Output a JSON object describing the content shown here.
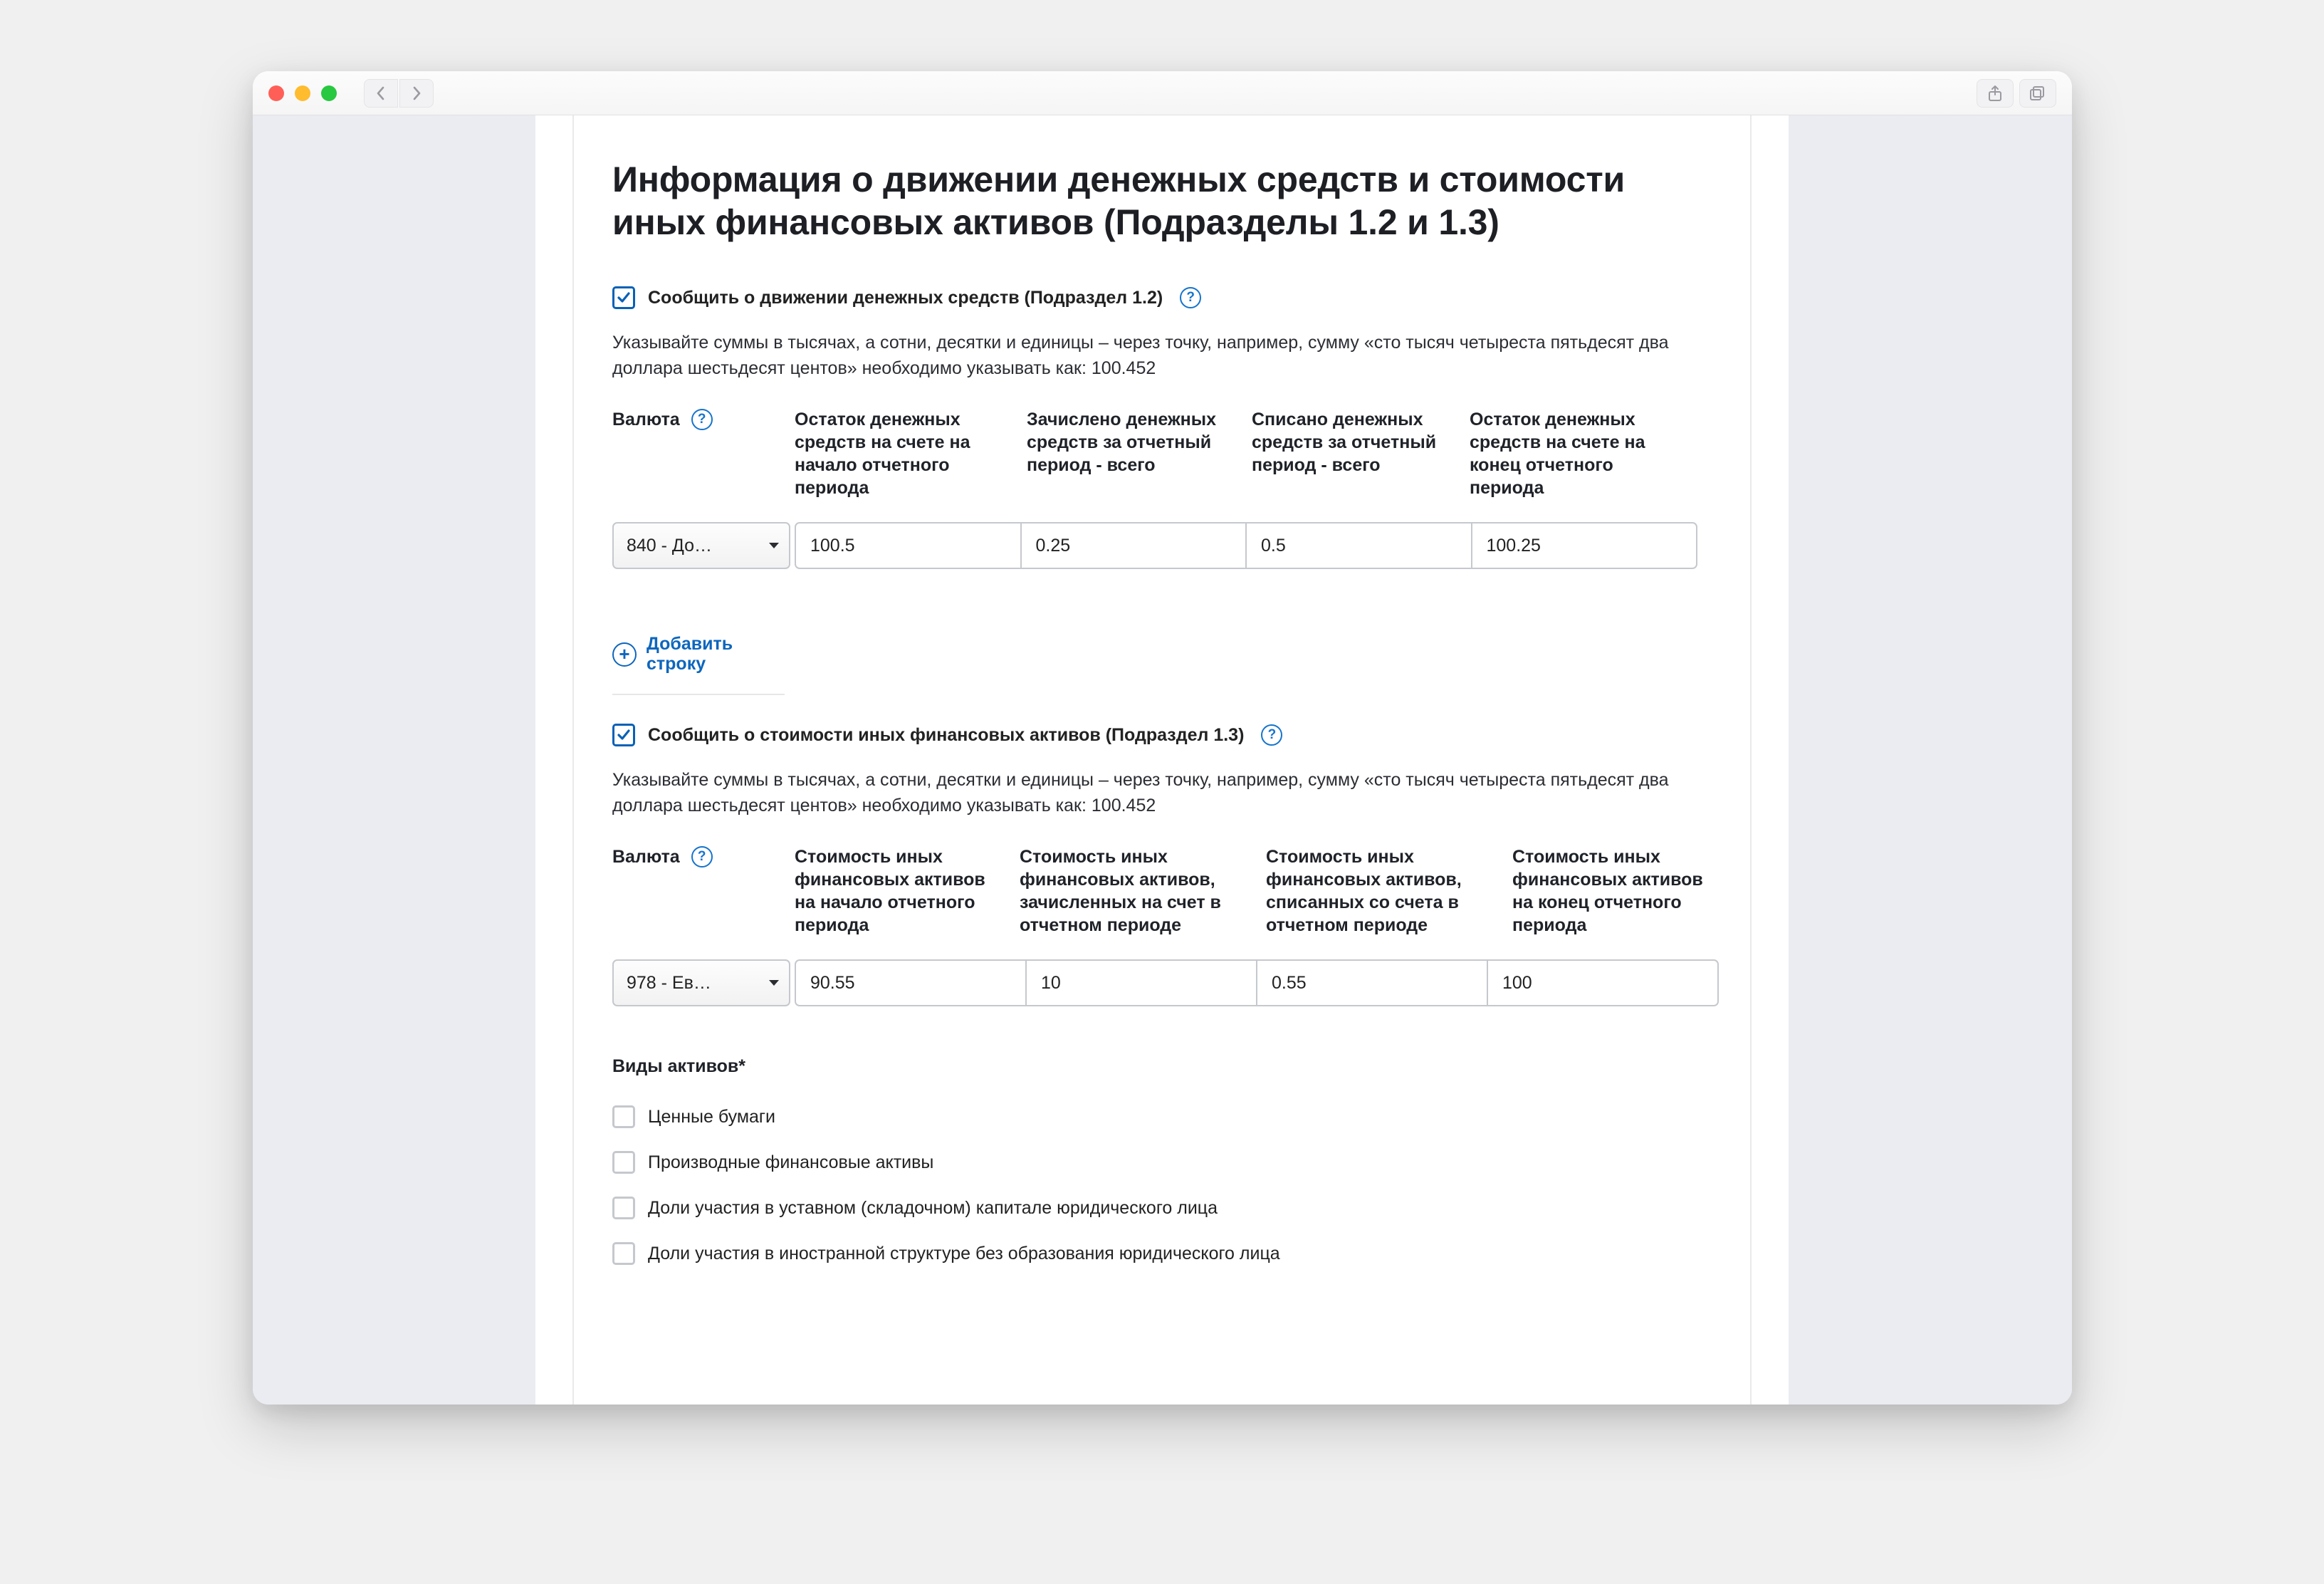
{
  "page": {
    "title": "Информация о движении денежных средств и стоимости иных финансовых активов (Подразделы 1.2 и 1.3)"
  },
  "section12": {
    "checkbox_label": "Сообщить о движении денежных средств (Подраздел 1.2)",
    "checked": true,
    "hint": "Указывайте суммы в тысячах, а сотни, десятки и единицы – через точку, например, сумму «сто тысяч четыреста пятьдесят два доллара шестьдесят центов» необходимо указывать как: 100.452",
    "columns": {
      "c0": "Валюта",
      "c1": "Остаток денежных средств на счете на начало отчетного периода",
      "c2": "Зачислено денежных средств за отчетный период - всего",
      "c3": "Списано денежных средств за отчетный период - всего",
      "c4": "Остаток денежных средств на счете на конец отчетного периода"
    },
    "row": {
      "currency": "840 - До…",
      "v1": "100.5",
      "v2": "0.25",
      "v3": "0.5",
      "v4": "100.25"
    },
    "add_row_label": "Добавить строку"
  },
  "section13": {
    "checkbox_label": "Сообщить о стоимости иных финансовых активов (Подраздел 1.3)",
    "checked": true,
    "hint": "Указывайте суммы в тысячах, а сотни, десятки и единицы – через точку, например, сумму «сто тысяч четыреста пятьдесят два доллара шестьдесят центов» необходимо указывать как: 100.452",
    "columns": {
      "c0": "Валюта",
      "c1": "Стоимость иных финансовых активов на начало отчетного периода",
      "c2": "Стоимость иных финансовых активов, зачисленных на счет в отчетном периоде",
      "c3": "Стоимость иных финансовых активов, списанных со счета в отчетном периоде",
      "c4": "Стоимость иных финансовых активов на конец отчетного периода"
    },
    "row": {
      "currency": "978 - Ев…",
      "v1": "90.55",
      "v2": "10",
      "v3": "0.55",
      "v4": "100"
    }
  },
  "assets": {
    "label": "Виды активов*",
    "items": [
      "Ценные бумаги",
      "Производные финансовые активы",
      "Доли участия в уставном (складочном) капитале юридического лица",
      "Доли участия в иностранной структуре без образования юридического лица"
    ]
  }
}
